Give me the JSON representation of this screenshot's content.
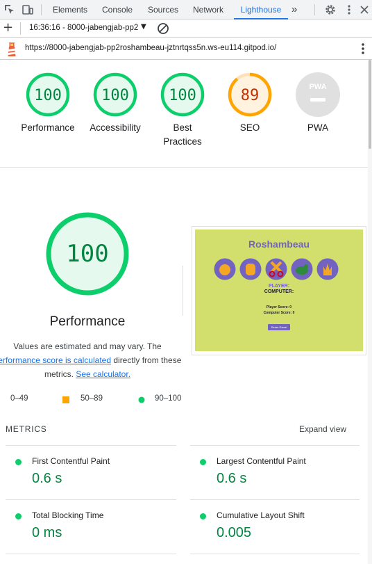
{
  "devtools": {
    "tabs": [
      "Elements",
      "Console",
      "Sources",
      "Network",
      "Lighthouse"
    ],
    "active_tab": "Lighthouse",
    "more": "»"
  },
  "toolbar": {
    "report_label": "16:36:16 - 8000-jabengjab-pp2",
    "add_icon": "plus-icon",
    "clear_icon": "clear-icon"
  },
  "urlbar": {
    "url": "https://8000-jabengjab-pp2roshambeau-jztnrtqss5n.ws-eu114.gitpod.io/"
  },
  "gauges": [
    {
      "label": "Performance",
      "score": "100",
      "color": "#0cce6b"
    },
    {
      "label": "Accessibility",
      "score": "100",
      "color": "#0cce6b"
    },
    {
      "label": "Best Practices",
      "score": "100",
      "color": "#0cce6b"
    },
    {
      "label": "SEO",
      "score": "89",
      "color": "#ffa400"
    },
    {
      "label": "PWA",
      "badge": "PWA"
    }
  ],
  "performance": {
    "score": "100",
    "title": "Performance",
    "note_1": "Values are estimated and may vary. The",
    "note_link_1": "performance score is calculated",
    "note_2": " directly from these metrics.",
    "note_link_2": "See calculator."
  },
  "legend": [
    {
      "range": "0–49",
      "color": "#ff4e42"
    },
    {
      "range": "50–89",
      "color": "#ffa400"
    },
    {
      "range": "90–100",
      "color": "#0cce6b"
    }
  ],
  "screenshot": {
    "title": "Roshambeau",
    "player": "PLAYER:",
    "computer": "COMPUTER:",
    "player_score": "Player Score: 0",
    "computer_score": "Computer Score: 0",
    "button": "Reset Game"
  },
  "metrics": {
    "heading": "METRICS",
    "expand": "Expand view",
    "items": [
      {
        "name": "First Contentful Paint",
        "value": "0.6 s"
      },
      {
        "name": "Largest Contentful Paint",
        "value": "0.6 s"
      },
      {
        "name": "Total Blocking Time",
        "value": "0 ms"
      },
      {
        "name": "Cumulative Layout Shift",
        "value": "0.005"
      }
    ]
  },
  "colors": {
    "pass": "#0cce6b",
    "average": "#ffa400",
    "fail": "#ff4e42",
    "pass_text": "#018642",
    "link": "#1a73e8"
  }
}
